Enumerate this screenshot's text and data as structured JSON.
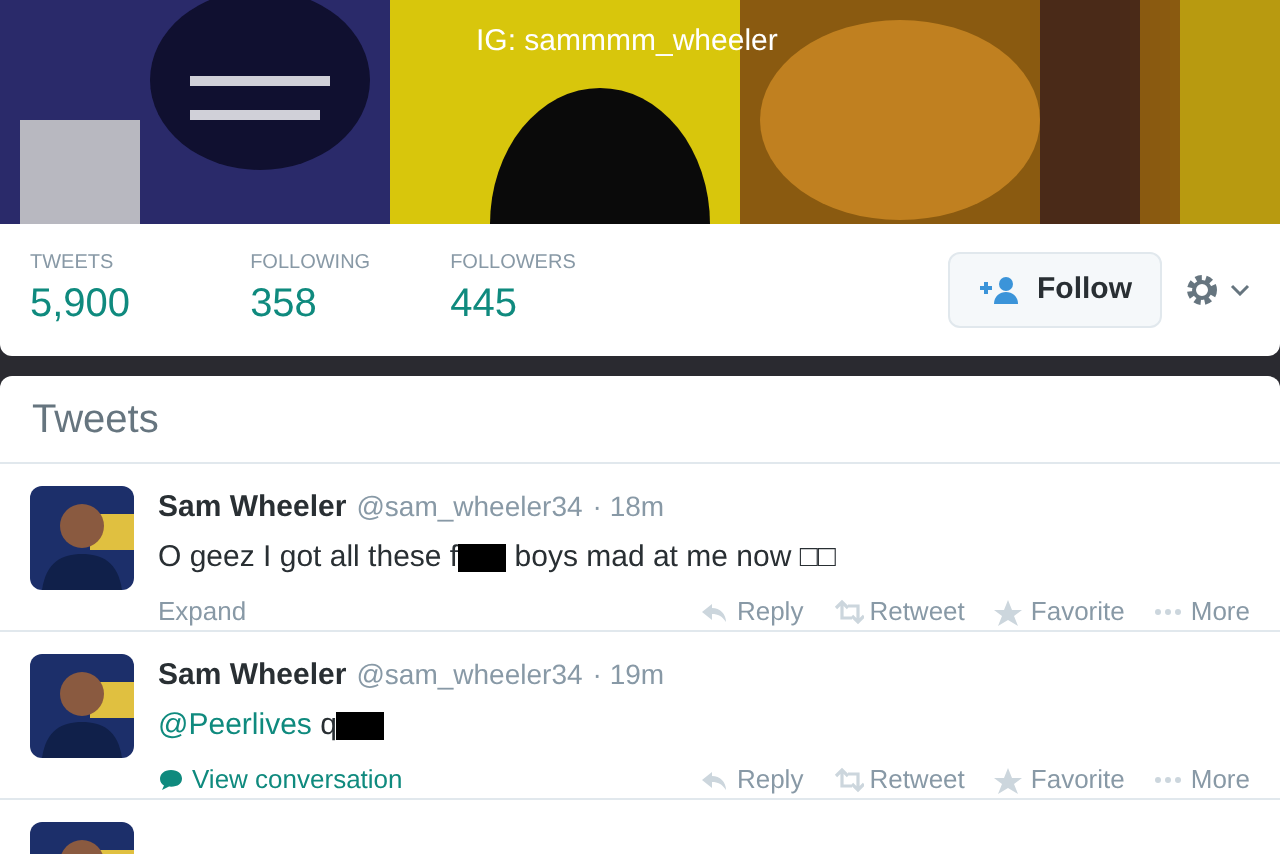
{
  "header": {
    "bio_line": "IG: sammmm_wheeler"
  },
  "stats": [
    {
      "label": "TWEETS",
      "value": "5,900"
    },
    {
      "label": "FOLLOWING",
      "value": "358"
    },
    {
      "label": "FOLLOWERS",
      "value": "445"
    }
  ],
  "follow_button": {
    "label": "Follow"
  },
  "timeline": {
    "title": "Tweets",
    "tweets": [
      {
        "name": "Sam Wheeler",
        "handle": "@sam_wheeler34",
        "time": "· 18m",
        "text_before": "O geez I got all these f",
        "redacted": true,
        "text_after": " boys mad at me now □□",
        "kind": "expand",
        "footer": "Expand",
        "actions": [
          "Reply",
          "Retweet",
          "Favorite",
          "More"
        ]
      },
      {
        "name": "Sam Wheeler",
        "handle": "@sam_wheeler34",
        "time": "· 19m",
        "mention": "@Peerlives",
        "text_before": " q",
        "redacted": true,
        "kind": "conversation",
        "footer": "View conversation",
        "actions": [
          "Reply",
          "Retweet",
          "Favorite",
          "More"
        ]
      }
    ]
  }
}
